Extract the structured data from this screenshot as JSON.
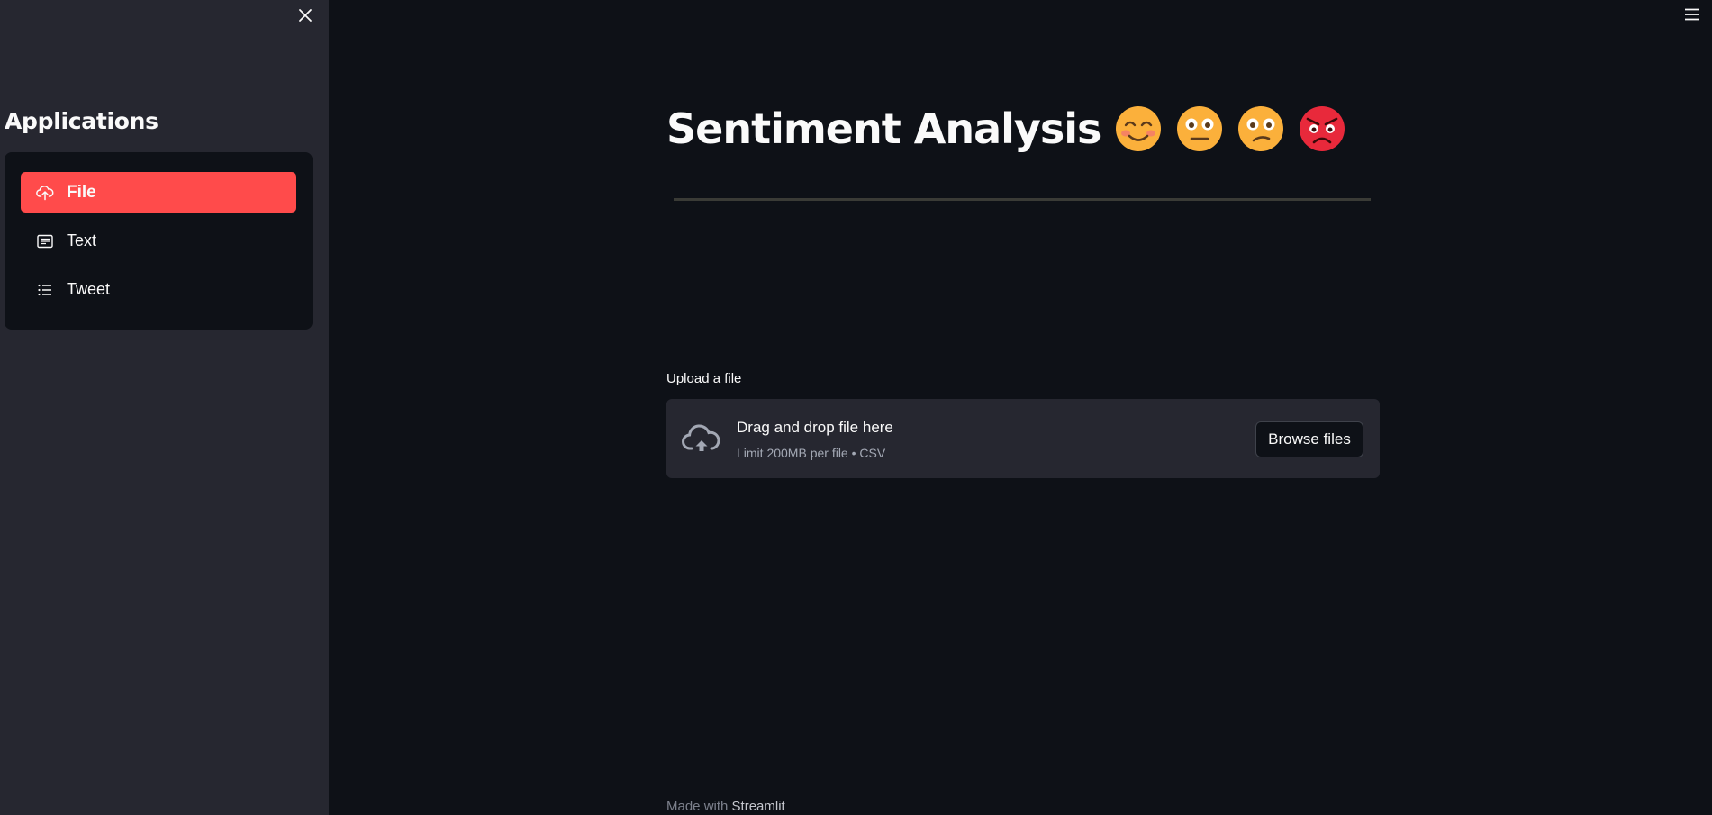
{
  "sidebar": {
    "heading": "Applications",
    "items": [
      {
        "label": "File",
        "icon": "cloud-upload-icon",
        "active": true
      },
      {
        "label": "Text",
        "icon": "text-document-icon",
        "active": false
      },
      {
        "label": "Tweet",
        "icon": "list-icon",
        "active": false
      }
    ]
  },
  "main": {
    "title": "Sentiment Analysis",
    "emojis": [
      "smiling-face-icon",
      "neutral-face-icon",
      "confused-face-icon",
      "angry-face-icon"
    ],
    "uploader": {
      "label": "Upload a file",
      "drop_text": "Drag and drop file here",
      "limit_text": "Limit 200MB per file • CSV",
      "browse_label": "Browse files"
    }
  },
  "footer": {
    "prefix": "Made with",
    "brand": "Streamlit"
  },
  "colors": {
    "accent": "#ff4b4b",
    "background": "#0e1117",
    "sidebar": "#262730"
  }
}
